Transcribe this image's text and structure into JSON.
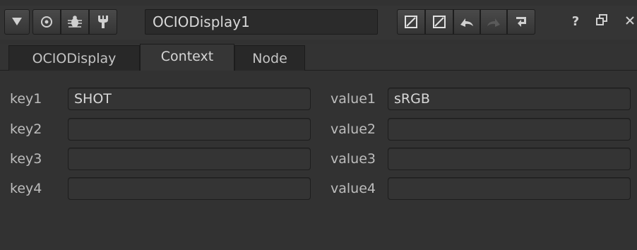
{
  "node": {
    "name": "OCIODisplay1"
  },
  "tabs": [
    {
      "label": "OCIODisplay"
    },
    {
      "label": "Context"
    },
    {
      "label": "Node"
    }
  ],
  "active_tab": "Context",
  "titlebar": {
    "help_label": "?",
    "icons": [
      "collapse-arrow-icon",
      "viewer-circle-icon",
      "bug-icon",
      "wrench-icon",
      "slash-box-icon",
      "slash-box-icon",
      "undo-icon",
      "redo-icon",
      "revert-icon",
      "help-icon",
      "float-window-icon",
      "close-icon"
    ]
  },
  "context": {
    "rows": [
      {
        "key_label": "key1",
        "key_value": "SHOT",
        "value_label": "value1",
        "value_value": "sRGB"
      },
      {
        "key_label": "key2",
        "key_value": "",
        "value_label": "value2",
        "value_value": ""
      },
      {
        "key_label": "key3",
        "key_value": "",
        "value_label": "value3",
        "value_value": ""
      },
      {
        "key_label": "key4",
        "key_value": "",
        "value_label": "value4",
        "value_value": ""
      }
    ]
  },
  "colors": {
    "panel_bg": "#323232",
    "field_bg": "#343434",
    "border": "#1d1d1d",
    "text": "#d8d8d8",
    "label_text": "#bdbdbd"
  }
}
